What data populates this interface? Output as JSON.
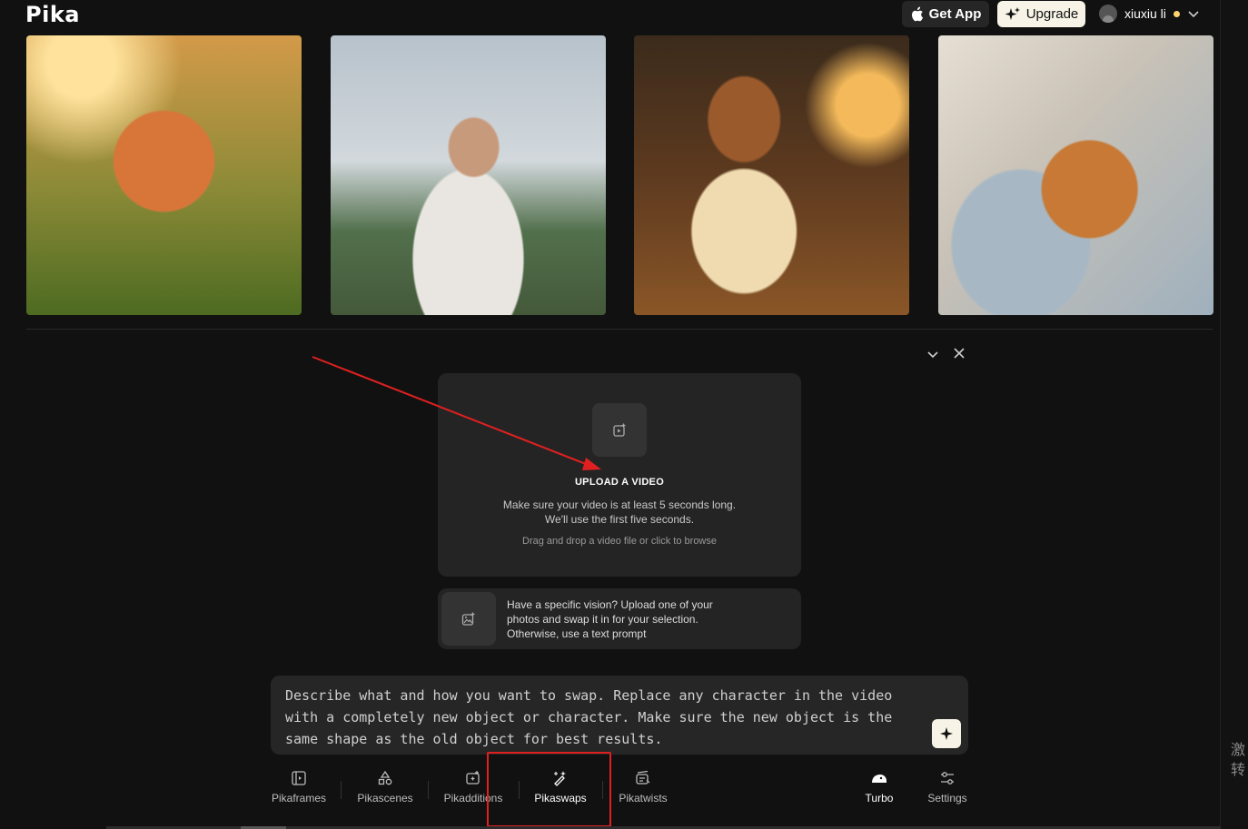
{
  "header": {
    "logo": "Pika",
    "get_app_label": "Get App",
    "upgrade_label": "Upgrade",
    "username": "xiuxiu li"
  },
  "gallery": {
    "items": [
      {
        "name": "monster"
      },
      {
        "name": "woman"
      },
      {
        "name": "boy-with-headphones"
      },
      {
        "name": "sleeping-cat"
      }
    ]
  },
  "upload": {
    "title": "UPLOAD A VIDEO",
    "desc_line1": "Make sure your video is at least 5 seconds long.",
    "desc_line2": "We'll use the first five seconds.",
    "hint": "Drag and drop a video file or click to browse"
  },
  "swap_image": {
    "text": "Have a specific vision? Upload one of your photos and swap it in for your selection. Otherwise, use a text prompt"
  },
  "prompt": {
    "placeholder": "Describe what and how you want to swap. Replace any character in the video with a completely new object or character. Make sure the new object is the same shape as the old object for best results."
  },
  "tools": {
    "pikaframes": "Pikaframes",
    "pikascenes": "Pikascenes",
    "pikadditions": "Pikadditions",
    "pikaswaps": "Pikaswaps",
    "pikatwists": "Pikatwists",
    "turbo": "Turbo",
    "settings": "Settings"
  },
  "side_text": "激\n转",
  "colors": {
    "background": "#111111",
    "card": "#242424",
    "accent": "#f7f3e6",
    "annotation": "#e02020",
    "status_dot": "#ffd36b"
  }
}
